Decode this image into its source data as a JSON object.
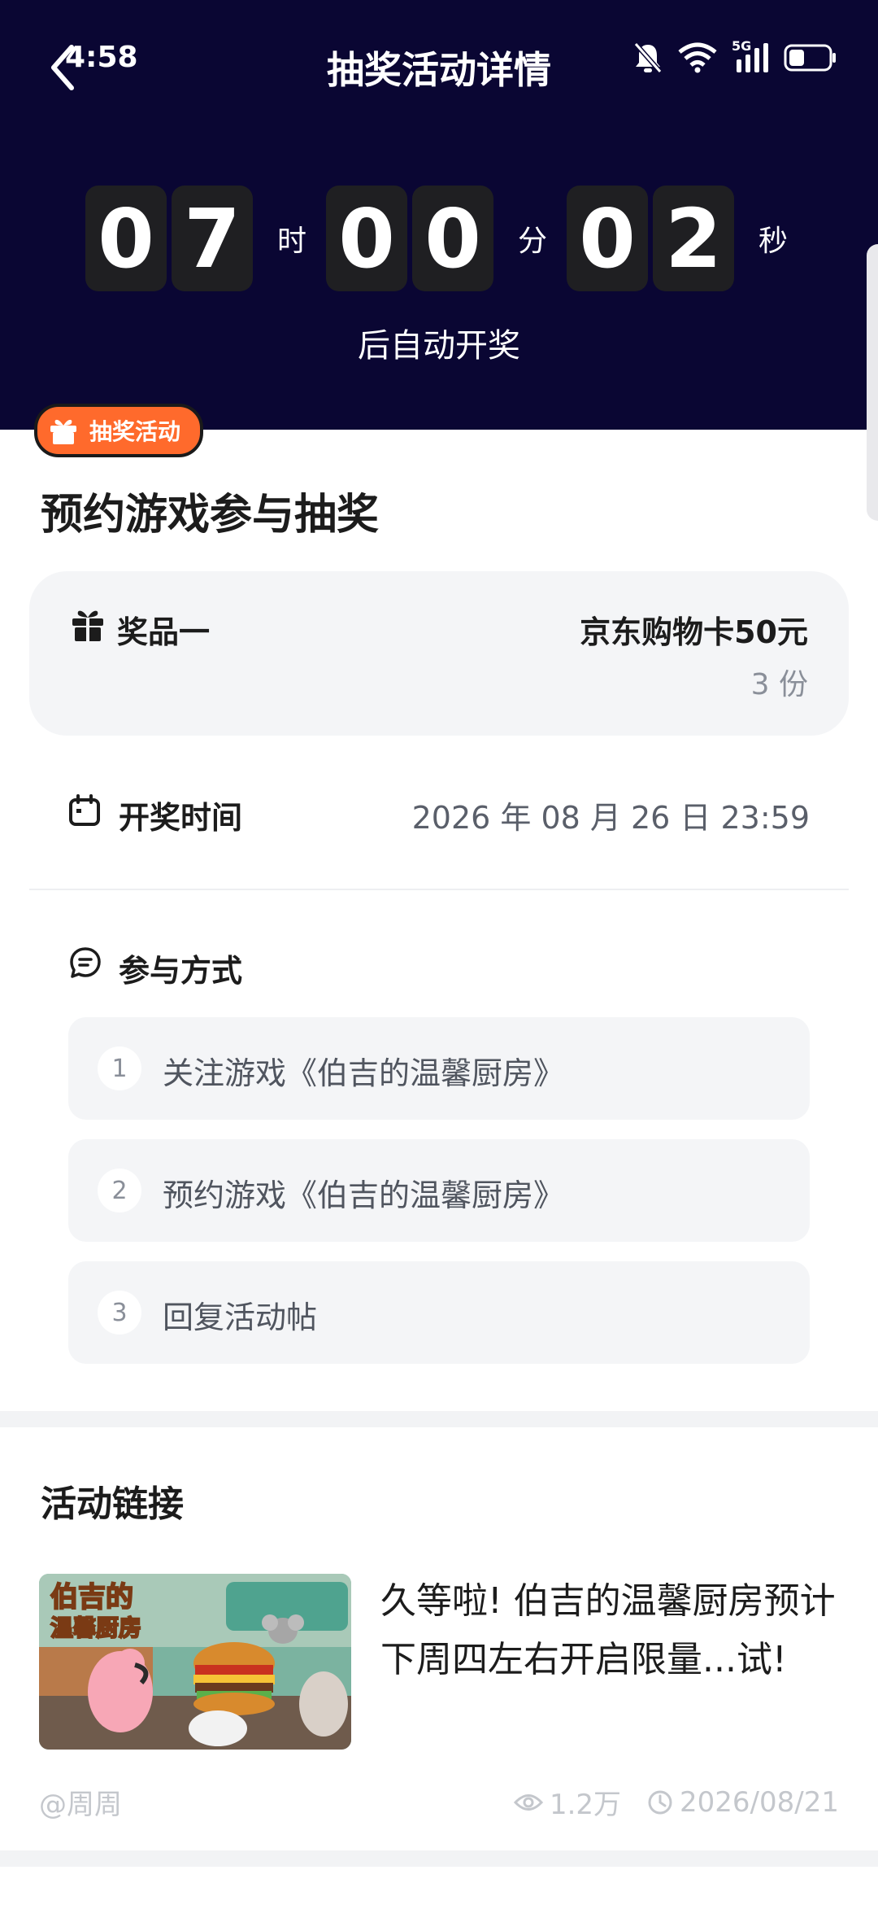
{
  "status_bar": {
    "time": "4:58",
    "network": "5G"
  },
  "header": {
    "title": "抽奖活动详情"
  },
  "countdown": {
    "hours": [
      "0",
      "7"
    ],
    "hours_unit": "时",
    "minutes": [
      "0",
      "0"
    ],
    "minutes_unit": "分",
    "seconds": [
      "0",
      "2"
    ],
    "seconds_unit": "秒",
    "caption": "后自动开奖"
  },
  "activity": {
    "badge": "抽奖活动",
    "title": "预约游戏参与抽奖",
    "prize": {
      "label": "奖品一",
      "name": "京东购物卡50元",
      "count": "3 份"
    },
    "draw_time": {
      "label": "开奖时间",
      "value": "2026 年 08 月 26 日 23:59"
    },
    "participation": {
      "label": "参与方式",
      "steps": [
        {
          "num": "1",
          "text": "关注游戏《伯吉的温馨厨房》"
        },
        {
          "num": "2",
          "text": "预约游戏《伯吉的温馨厨房》"
        },
        {
          "num": "3",
          "text": "回复活动帖"
        }
      ]
    }
  },
  "links": {
    "title": "活动链接",
    "item": {
      "thumb_text_line1": "伯吉的",
      "thumb_text_line2": "温馨厨房",
      "title": "久等啦! 伯吉的温馨厨房预计下周四左右开启限量...试!",
      "author": "@周周",
      "views": "1.2万",
      "date": "2026/08/21"
    }
  },
  "colors": {
    "header_bg": "#0a0633",
    "badge_bg": "#ff6a2c",
    "digit_bg": "#1f1f22"
  }
}
